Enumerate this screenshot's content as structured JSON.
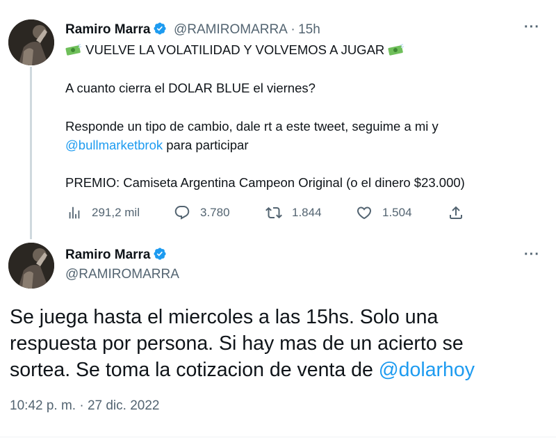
{
  "tweet1": {
    "name": "Ramiro Marra",
    "handle": "@RAMIROMARRA",
    "separator": "·",
    "time_ago": "15h",
    "more_label": "···",
    "headline": "VUELVE LA VOLATILIDAD Y VOLVEMOS A JUGAR",
    "line_question": "A cuanto cierra el DOLAR BLUE el viernes?",
    "line_instructions": "Responde un tipo de cambio, dale rt a este tweet, seguime a mi y",
    "mention": "@bullmarketbrok",
    "line_instructions_end": " para participar",
    "line_prize": "PREMIO: Camiseta Argentina Campeon Original (o el dinero $23.000)",
    "metrics": {
      "views": "291,2 mil",
      "replies": "3.780",
      "retweets": "1.844",
      "likes": "1.504"
    }
  },
  "tweet2": {
    "name": "Ramiro Marra",
    "handle": "@RAMIROMARRA",
    "more_label": "···",
    "text_line1": "Se juega hasta el miercoles a las 15hs. Solo una",
    "text_line2": "respuesta por persona. Si hay mas de un acierto se",
    "text_line3": "sortea. Se toma la cotizacion de venta de ",
    "mention": "@dolarhoy",
    "timestamp": "10:42 p. m. · 27 dic. 2022"
  },
  "colors": {
    "text": "#0f1419",
    "muted": "#536471",
    "accent": "#1d9bf0",
    "thread_line": "#cfd9de"
  },
  "icons": [
    "verified-badge-icon",
    "money-bag-icon",
    "views-icon",
    "reply-icon",
    "retweet-icon",
    "like-icon",
    "share-icon",
    "more-icon"
  ]
}
